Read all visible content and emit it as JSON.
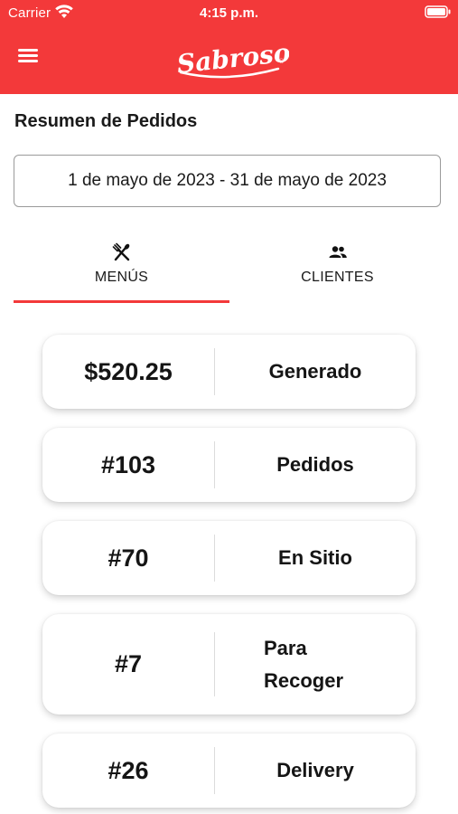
{
  "status_bar": {
    "carrier": "Carrier",
    "time": "4:15 p.m."
  },
  "header": {
    "brand": "Sabroso",
    "brand_mark": "®"
  },
  "colors": {
    "brand_red": "#f3393a",
    "text_dark": "#151515",
    "field_border": "#9a9a9a"
  },
  "summary": {
    "title": "Resumen de Pedidos",
    "date_range": "1 de mayo de 2023 - 31 de mayo de 2023"
  },
  "tabs": [
    {
      "label": "MENÚS",
      "icon": "utensils-icon",
      "active": true
    },
    {
      "label": "CLIENTES",
      "icon": "people-icon",
      "active": false
    }
  ],
  "stats": [
    {
      "value": "$520.25",
      "label": "Generado"
    },
    {
      "value": "#103",
      "label": "Pedidos"
    },
    {
      "value": "#70",
      "label": "En Sitio"
    },
    {
      "value": "#7",
      "label_line1": "Para",
      "label_line2": "Recoger"
    },
    {
      "value": "#26",
      "label": "Delivery"
    }
  ]
}
